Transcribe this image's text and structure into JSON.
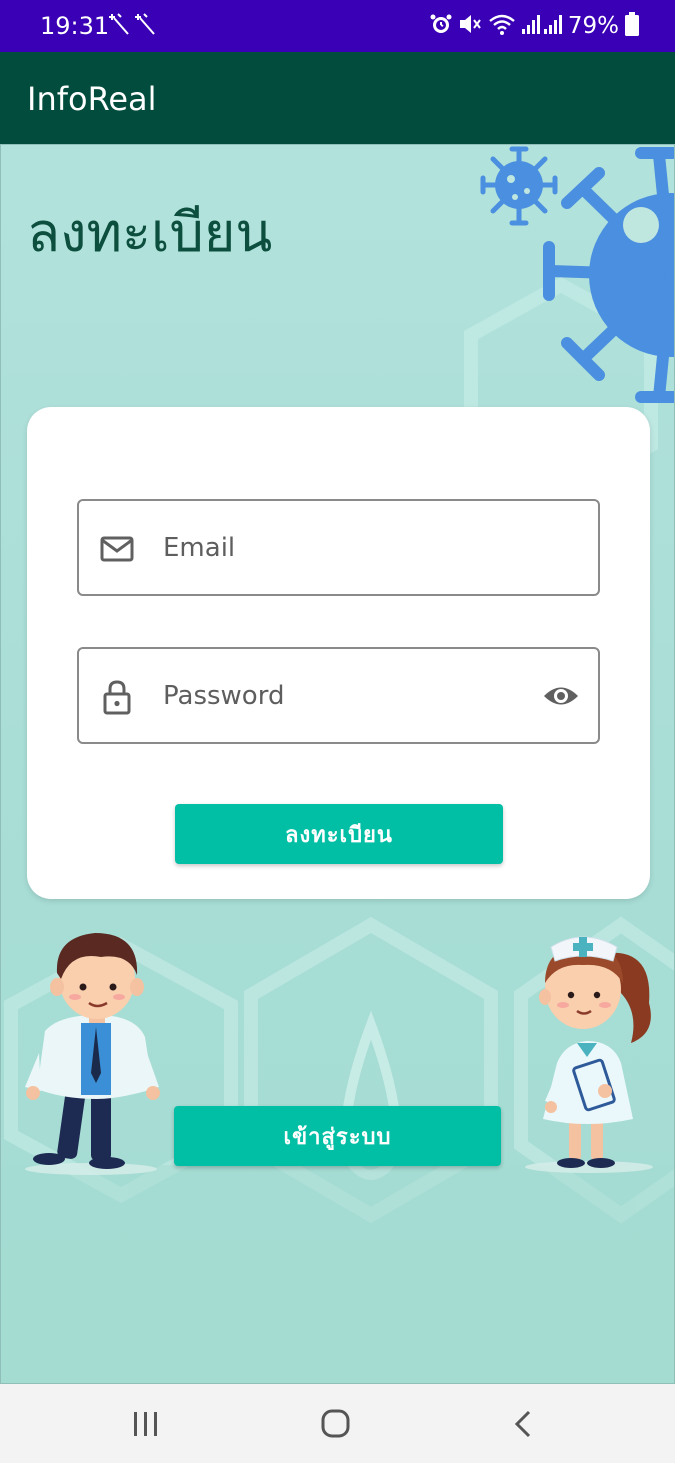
{
  "status_bar": {
    "time": "19:31",
    "battery": "79%"
  },
  "app_bar": {
    "title": "InfoReal"
  },
  "register_page": {
    "title": "ลงทะเบียน",
    "email_placeholder": "Email",
    "password_placeholder": "Password",
    "register_button": "ลงทะเบียน",
    "login_button": "เข้าสู่ระบบ"
  },
  "colors": {
    "status_bar": "#3a00b5",
    "app_bar": "#014c3c",
    "accent": "#00bfa5",
    "virus": "#4a8fe0"
  },
  "icons": [
    "sparkle-icon",
    "alarm-icon",
    "mute-icon",
    "wifi-icon",
    "signal-icon",
    "battery-icon",
    "mail-icon",
    "lock-icon",
    "eye-icon",
    "recents-icon",
    "home-icon",
    "back-icon"
  ]
}
